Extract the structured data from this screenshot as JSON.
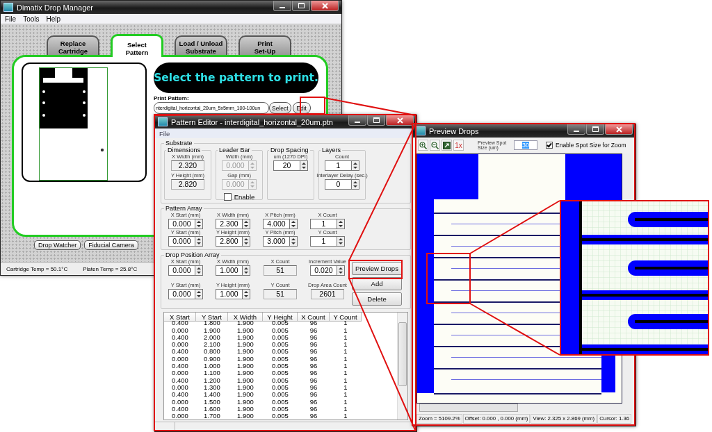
{
  "drop_manager": {
    "title": "Dimatix Drop Manager",
    "menu": [
      "File",
      "Tools",
      "Help"
    ],
    "tabs": [
      {
        "label": "Replace\nCartridge",
        "selected": false
      },
      {
        "label": "Select\nPattern",
        "selected": true
      },
      {
        "label": "Load / Unload\nSubstrate",
        "selected": false
      },
      {
        "label": "Print\nSet-Up",
        "selected": false
      }
    ],
    "banner": "Select the pattern to print.",
    "print_pattern": {
      "label": "Print Pattern:",
      "value": "nterdigital_horizontal_20um_5x5mm_100-100un"
    },
    "field_buttons": [
      "Select",
      "Edit"
    ],
    "bottom_buttons": [
      "Drop Watcher",
      "Fiducial Camera"
    ],
    "status_bar": [
      "Cartridge Temp = 50.1°C",
      "Platen Temp = 25.8°C"
    ]
  },
  "pattern_editor": {
    "title": "Pattern Editor - interdigital_horizontal_20um.ptn",
    "menu": [
      "File"
    ],
    "substrate": {
      "legend": "Substrate",
      "groups": [
        {
          "legend": "Dimensions",
          "fields": [
            {
              "kind": "readout",
              "label": "X Width (mm)",
              "value": "2.320"
            },
            {
              "kind": "readout",
              "label": "Y Height (mm)",
              "value": "2.820"
            }
          ]
        },
        {
          "legend": "Leader Bar",
          "fields": [
            {
              "kind": "spin",
              "label": "Width (mm)",
              "value": "0.000",
              "disabled": true
            },
            {
              "kind": "spin",
              "label": "Gap (mm)",
              "value": "0.000",
              "disabled": true
            },
            {
              "kind": "checkbox",
              "label": "Enable",
              "checked": false,
              "disabled": false
            }
          ]
        },
        {
          "legend": "Drop Spacing",
          "fields": [
            {
              "kind": "spin",
              "label": "um (1270 DPI)",
              "value": "20"
            }
          ]
        },
        {
          "legend": "Layers",
          "fields": [
            {
              "kind": "spin",
              "label": "Count",
              "value": "1"
            },
            {
              "kind": "spin",
              "label": "Interlayer Delay (sec.)",
              "value": "0"
            }
          ]
        }
      ]
    },
    "pattern_array": {
      "legend": "Pattern Array",
      "rows": [
        [
          {
            "kind": "spin",
            "label": "X Start (mm)",
            "value": "0.000"
          },
          {
            "kind": "spin",
            "label": "X Width (mm)",
            "value": "2.300"
          },
          {
            "kind": "spin",
            "label": "X Pitch (mm)",
            "value": "4.000"
          },
          {
            "kind": "spin",
            "label": "X Count",
            "value": "1"
          }
        ],
        [
          {
            "kind": "spin",
            "label": "Y Start (mm)",
            "value": "0.000"
          },
          {
            "kind": "spin",
            "label": "Y Height (mm)",
            "value": "2.800"
          },
          {
            "kind": "spin",
            "label": "Y Pitch (mm)",
            "value": "3.000"
          },
          {
            "kind": "spin",
            "label": "Y Count",
            "value": "1"
          }
        ]
      ]
    },
    "drop_position_array": {
      "legend": "Drop Position Array",
      "rows": [
        [
          {
            "kind": "spin",
            "label": "X Start (mm)",
            "value": "0.000"
          },
          {
            "kind": "spin",
            "label": "X Width (mm)",
            "value": "1.000"
          },
          {
            "kind": "readout",
            "label": "X Count",
            "value": "51"
          },
          {
            "kind": "spin",
            "label": "Increment Value",
            "value": "0.020"
          }
        ],
        [
          {
            "kind": "spin",
            "label": "Y Start (mm)",
            "value": "0.000"
          },
          {
            "kind": "spin",
            "label": "Y Height (mm)",
            "value": "1.000"
          },
          {
            "kind": "readout",
            "label": "Y Count",
            "value": "51"
          },
          {
            "kind": "readout",
            "label": "Drop Area Count",
            "value": "2601"
          }
        ]
      ]
    },
    "buttons": [
      "Preview Drops",
      "Add",
      "Delete"
    ],
    "table": {
      "columns": [
        "X Start",
        "Y Start",
        "X Width",
        "Y Height",
        "X Count",
        "Y Count"
      ],
      "rows": [
        [
          "0.400",
          "1.800",
          "1.900",
          "0.005",
          "96",
          "1"
        ],
        [
          "0.000",
          "1.900",
          "1.900",
          "0.005",
          "96",
          "1"
        ],
        [
          "0.400",
          "2.000",
          "1.900",
          "0.005",
          "96",
          "1"
        ],
        [
          "0.000",
          "2.100",
          "1.900",
          "0.005",
          "96",
          "1"
        ],
        [
          "0.400",
          "0.800",
          "1.900",
          "0.005",
          "96",
          "1"
        ],
        [
          "0.000",
          "0.900",
          "1.900",
          "0.005",
          "96",
          "1"
        ],
        [
          "0.400",
          "1.000",
          "1.900",
          "0.005",
          "96",
          "1"
        ],
        [
          "0.000",
          "1.100",
          "1.900",
          "0.005",
          "96",
          "1"
        ],
        [
          "0.400",
          "1.200",
          "1.900",
          "0.005",
          "96",
          "1"
        ],
        [
          "0.000",
          "1.300",
          "1.900",
          "0.005",
          "96",
          "1"
        ],
        [
          "0.400",
          "1.400",
          "1.900",
          "0.005",
          "96",
          "1"
        ],
        [
          "0.000",
          "1.500",
          "1.900",
          "0.005",
          "96",
          "1"
        ],
        [
          "0.400",
          "1.600",
          "1.900",
          "0.005",
          "96",
          "1"
        ],
        [
          "0.000",
          "1.700",
          "1.900",
          "0.005",
          "96",
          "1"
        ]
      ]
    }
  },
  "preview_drops": {
    "title": "Preview Drops",
    "toolbar": {
      "zoom_button": "1x",
      "spot_size": {
        "label": "Preview Spot Size (um)",
        "value": "30",
        "text_selected": true
      },
      "checkbox": {
        "label": "Enable Spot Size for Zoom",
        "checked": true
      }
    },
    "status_bar": [
      "Zoom = 5109.2%",
      "Offset: 0.000 , 0.000 (mm)",
      "View: 2.325 x 2.869 (mm)",
      "Cursor: 1.36"
    ]
  }
}
